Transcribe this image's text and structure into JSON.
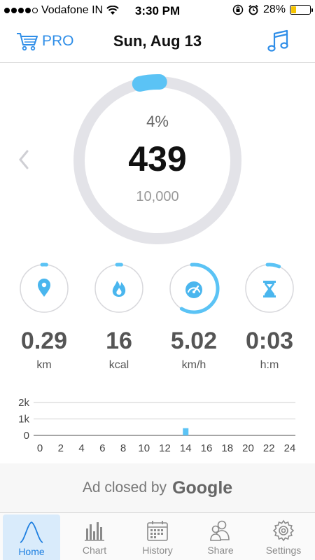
{
  "status_bar": {
    "carrier": "Vodafone IN",
    "time": "3:30 PM",
    "battery": "28%",
    "battery_level": 0.28
  },
  "header": {
    "pro_label": "PRO",
    "date": "Sun, Aug 13"
  },
  "summary": {
    "percent": "4%",
    "steps": "439",
    "goal": "10,000",
    "progress_fraction": 0.04
  },
  "stats": [
    {
      "value": "0.29",
      "unit": "km",
      "icon": "location-pin-icon",
      "progress": 0.03
    },
    {
      "value": "16",
      "unit": "kcal",
      "icon": "flame-icon",
      "progress": 0.03
    },
    {
      "value": "5.02",
      "unit": "km/h",
      "icon": "speedometer-icon",
      "progress": 0.6
    },
    {
      "value": "0:03",
      "unit": "h:m",
      "icon": "hourglass-icon",
      "progress": 0.08
    }
  ],
  "chart_data": {
    "type": "bar",
    "x_ticks": [
      "0",
      "2",
      "4",
      "6",
      "8",
      "10",
      "12",
      "14",
      "16",
      "18",
      "20",
      "22",
      "24"
    ],
    "y_ticks": [
      "2k",
      "1k",
      "0"
    ],
    "ylim": [
      0,
      2000
    ],
    "xlim": [
      0,
      24
    ],
    "bars": [
      {
        "hour": 14,
        "steps": 439
      }
    ],
    "grid": true
  },
  "ad": {
    "text": "Ad closed by",
    "brand": "Google"
  },
  "tabs": [
    {
      "label": "Home",
      "icon": "home-peak-icon",
      "active": true
    },
    {
      "label": "Chart",
      "icon": "bar-chart-icon",
      "active": false
    },
    {
      "label": "History",
      "icon": "calendar-icon",
      "active": false
    },
    {
      "label": "Share",
      "icon": "share-people-icon",
      "active": false
    },
    {
      "label": "Settings",
      "icon": "gear-icon",
      "active": false
    }
  ],
  "colors": {
    "accent": "#5bc3f5",
    "ring_track": "#e3e3e8",
    "link": "#2f8ee8"
  }
}
